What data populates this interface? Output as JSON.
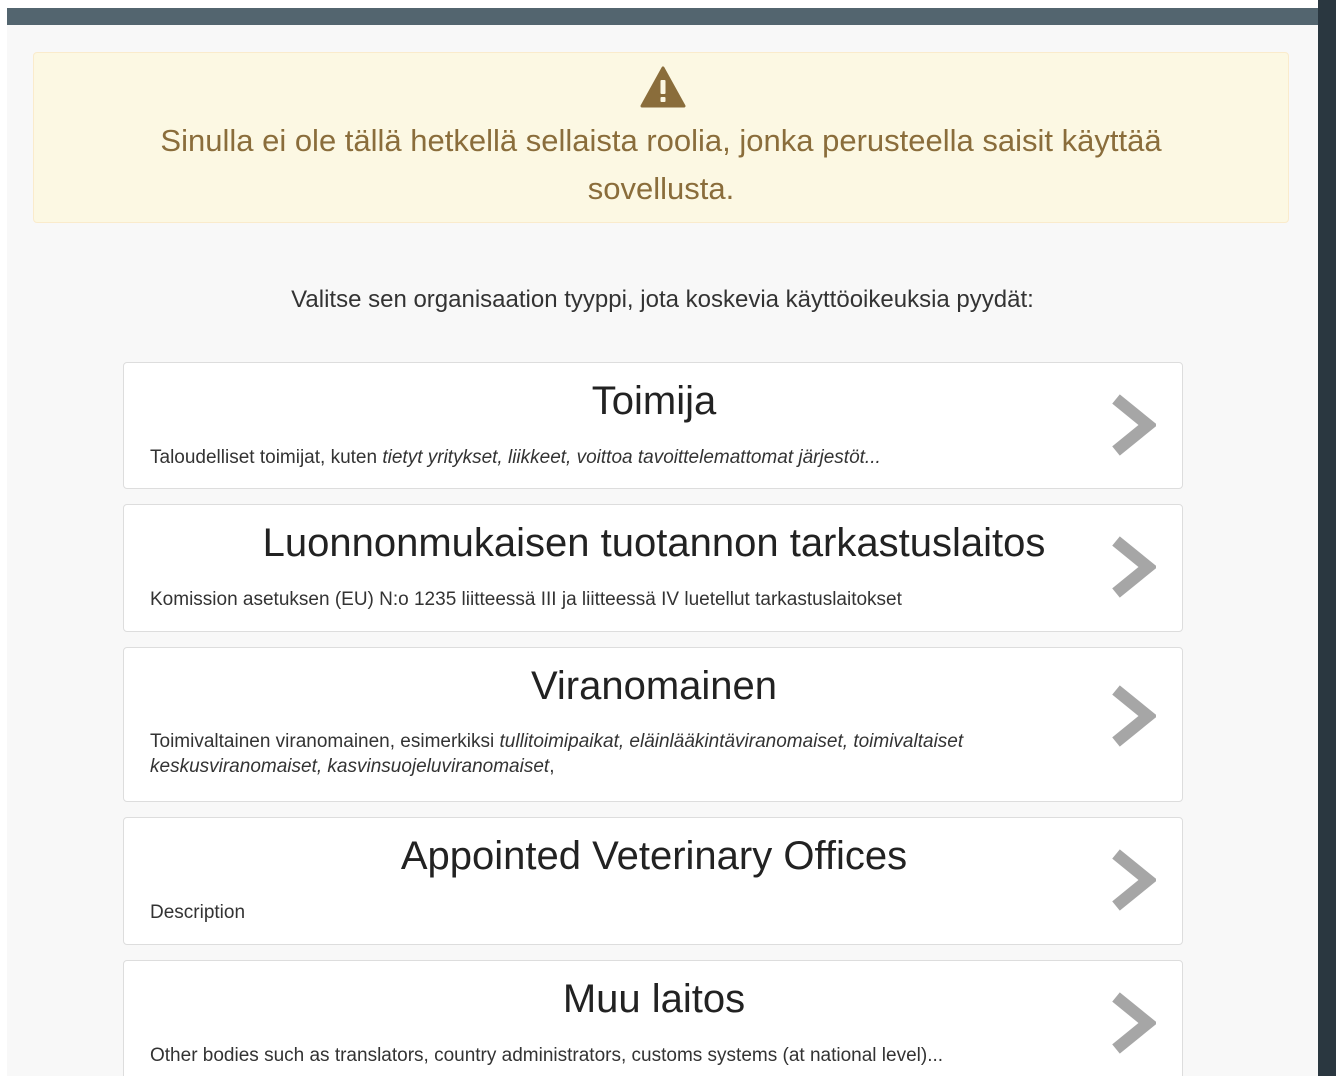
{
  "alert": {
    "icon": "warning-triangle-icon",
    "message": "Sinulla ei ole tällä hetkellä sellaista roolia, jonka perusteella saisit käyttää sovellusta."
  },
  "prompt": "Valitse sen organisaation tyyppi, jota koskevia käyttöoikeuksia pyydät:",
  "org_types": [
    {
      "title": "Toimija",
      "desc_plain": "Taloudelliset toimijat, kuten ",
      "desc_italic": "tietyt yritykset, liikkeet, voittoa tavoittelemattomat järjestöt...",
      "desc_tail": ""
    },
    {
      "title": "Luonnonmukaisen tuotannon tarkastuslaitos",
      "desc_plain": "Komission asetuksen (EU) N:o 1235 liitteessä III ja liitteessä IV luetellut tarkastuslaitokset",
      "desc_italic": "",
      "desc_tail": ""
    },
    {
      "title": "Viranomainen",
      "desc_plain": "Toimivaltainen viranomainen, esimerkiksi ",
      "desc_italic": "tullitoimipaikat, eläinlääkintäviranomaiset, toimivaltaiset keskusviranomaiset, kasvinsuojeluviranomaiset",
      "desc_tail": ","
    },
    {
      "title": "Appointed Veterinary Offices",
      "desc_plain": "Description",
      "desc_italic": "",
      "desc_tail": ""
    },
    {
      "title": "Muu laitos",
      "desc_plain": "Other bodies such as translators, country administrators, customs systems (at national level)...",
      "desc_italic": "",
      "desc_tail": ""
    }
  ],
  "colors": {
    "alert_bg": "#fcf8e3",
    "alert_text": "#8a6d3b",
    "chevron": "#a6a6a6",
    "topbar": "#53656f"
  }
}
